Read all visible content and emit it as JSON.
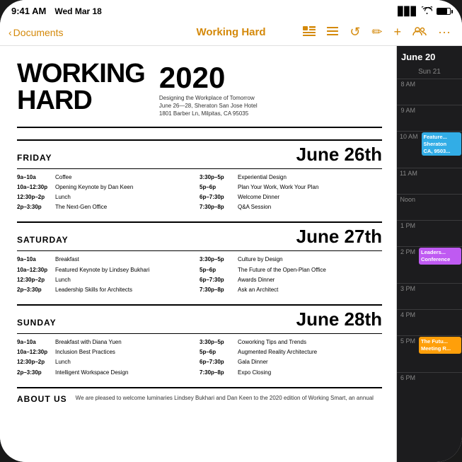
{
  "statusBar": {
    "time": "9:41 AM",
    "date": "Wed Mar 18",
    "icons": [
      "battery",
      "wifi",
      "signal"
    ]
  },
  "toolbar": {
    "back_label": "Documents",
    "title": "Working Hard",
    "icons": [
      "layout",
      "list",
      "clock",
      "pen",
      "plus",
      "people",
      "ellipsis"
    ]
  },
  "document": {
    "title_line1": "WORKING",
    "title_line2": "HARD",
    "year": "2020",
    "subtitle_line1": "Designing the Workplace of Tomorrow",
    "subtitle_line2": "June 26—28, Sheraton San Jose Hotel",
    "subtitle_line3": "1801 Barber Ln, Milpitas, CA 95035",
    "days": [
      {
        "name": "FRIDAY",
        "date": "June 26th",
        "col1": [
          {
            "time": "9a–10a",
            "event": "Coffee"
          },
          {
            "time": "10a–12:30p",
            "event": "Opening Keynote by Dan Keen"
          },
          {
            "time": "12:30p–2p",
            "event": "Lunch"
          },
          {
            "time": "2p–3:30p",
            "event": "The Next-Gen Office"
          }
        ],
        "col2": [
          {
            "time": "3:30p–5p",
            "event": "Experiential Design"
          },
          {
            "time": "5p–6p",
            "event": "Plan Your Work, Work Your Plan"
          },
          {
            "time": "6p–7:30p",
            "event": "Welcome Dinner"
          },
          {
            "time": "7:30p–8p",
            "event": "Q&A Session"
          }
        ]
      },
      {
        "name": "SATURDAY",
        "date": "June 27th",
        "col1": [
          {
            "time": "9a–10a",
            "event": "Breakfast"
          },
          {
            "time": "10a–12:30p",
            "event": "Featured Keynote by Lindsey Bukhari"
          },
          {
            "time": "12:30p–2p",
            "event": "Lunch"
          },
          {
            "time": "2p–3:30p",
            "event": "Leadership Skills for Architects"
          }
        ],
        "col2": [
          {
            "time": "3:30p–5p",
            "event": "Culture by Design"
          },
          {
            "time": "5p–6p",
            "event": "The Future of the Open-Plan Office"
          },
          {
            "time": "6p–7:30p",
            "event": "Awards Dinner"
          },
          {
            "time": "7:30p–8p",
            "event": "Ask an Architect"
          }
        ]
      },
      {
        "name": "SUNDAY",
        "date": "June 28th",
        "col1": [
          {
            "time": "9a–10a",
            "event": "Breakfast with Diana Yuen"
          },
          {
            "time": "10a–12:30p",
            "event": "Inclusion Best Practices"
          },
          {
            "time": "12:30p–2p",
            "event": "Lunch"
          },
          {
            "time": "2p–3:30p",
            "event": "Intelligent Workspace Design"
          }
        ],
        "col2": [
          {
            "time": "3:30p–5p",
            "event": "Coworking Tips and Trends"
          },
          {
            "time": "5p–6p",
            "event": "Augmented Reality Architecture"
          },
          {
            "time": "6p–7:30p",
            "event": "Gala Dinner"
          },
          {
            "time": "7:30p–8p",
            "event": "Expo Closing"
          }
        ]
      }
    ],
    "about_title": "ABOUT US",
    "about_text": "We are pleased to welcome luminaries Lindsey Bukhari and Dan Keen to the 2020 edition of Working Smart, an annual"
  },
  "calendar": {
    "header": "June 20",
    "day_label": "Sun 21",
    "times": [
      "8 AM",
      "9 AM",
      "10 AM",
      "11 AM",
      "Noon",
      "1 PM",
      "2 PM",
      "3 PM",
      "4 PM",
      "5 PM",
      "6 PM"
    ],
    "events": [
      {
        "time_index": 2,
        "label": "Feature...\nSheraton\nCA, 9503...",
        "color": "cyan"
      },
      {
        "time_index": 6,
        "label": "Leaders...\nConference",
        "color": "purple"
      },
      {
        "time_index": 9,
        "label": "The Futu...\nMeeting R...",
        "color": "orange"
      }
    ]
  }
}
